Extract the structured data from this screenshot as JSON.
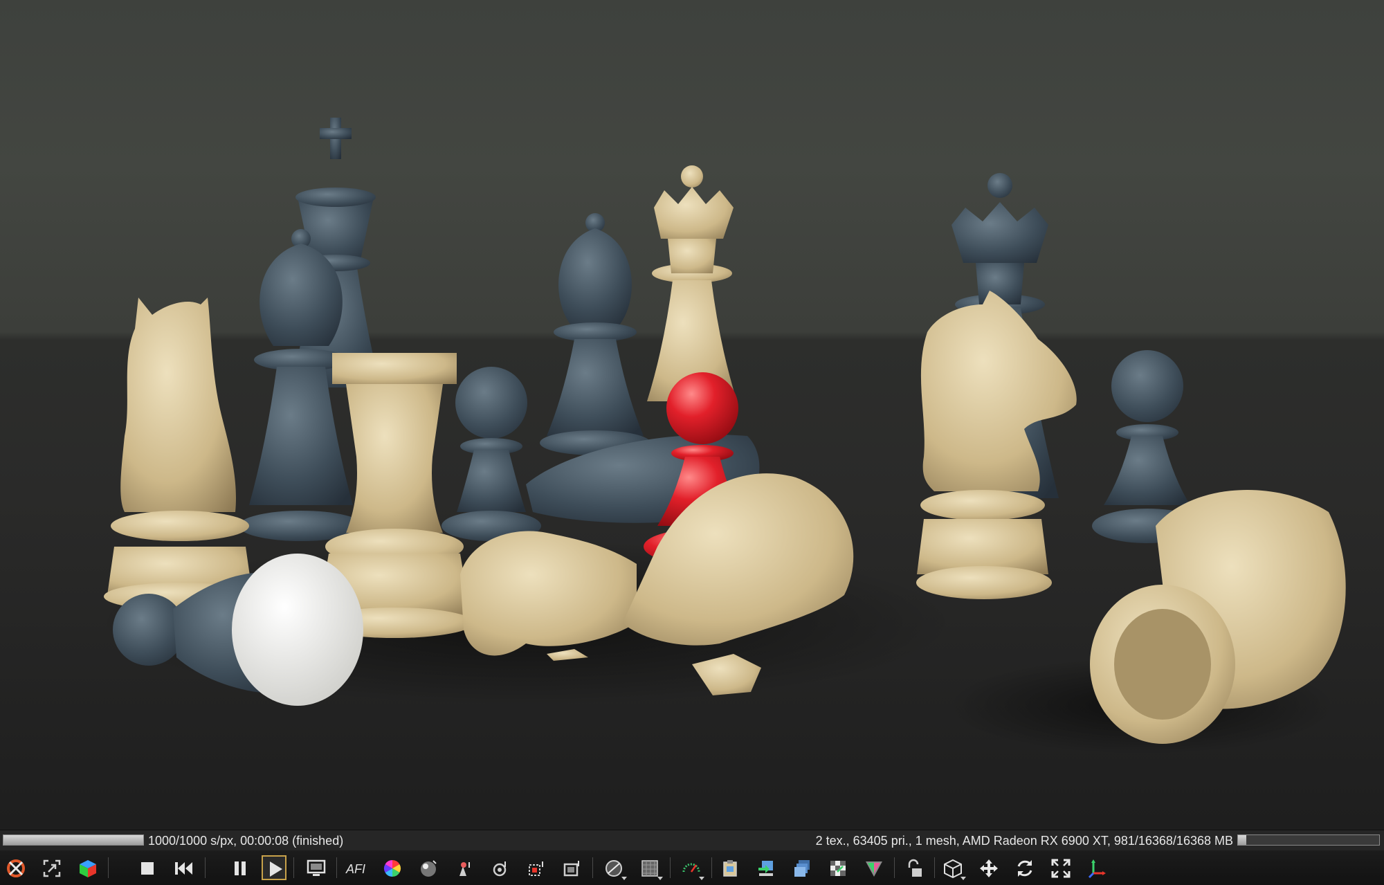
{
  "status": {
    "render_progress": 1.0,
    "gpu_progress": 0.06,
    "left_text": "1000/1000 s/px, 00:00:08 (finished)",
    "right_text": "2 tex., 63405 pri., 1 mesh, AMD Radeon RX 6900 XT, 981/16368/16368 MB"
  },
  "toolbar": {
    "afi_label": "AFI",
    "buttons": [
      {
        "name": "render-reset-icon"
      },
      {
        "name": "region-select-icon"
      },
      {
        "name": "color-cube-icon"
      },
      {
        "name": "stop-icon"
      },
      {
        "name": "restart-icon"
      },
      {
        "name": "pause-icon"
      },
      {
        "name": "play-icon",
        "active": true
      },
      {
        "name": "display-settings-icon"
      },
      {
        "name": "afi-icon"
      },
      {
        "name": "color-wheel-icon"
      },
      {
        "name": "material-sphere-icon"
      },
      {
        "name": "light-pick-icon"
      },
      {
        "name": "camera-pick-icon"
      },
      {
        "name": "region-render-icon"
      },
      {
        "name": "film-region-icon"
      },
      {
        "name": "lens-icon"
      },
      {
        "name": "alpha-grid-icon"
      },
      {
        "name": "performance-gauge-icon"
      },
      {
        "name": "copy-clipboard-icon"
      },
      {
        "name": "save-image-icon"
      },
      {
        "name": "layers-icon"
      },
      {
        "name": "checker-icon"
      },
      {
        "name": "prism-icon"
      },
      {
        "name": "lock-icon"
      },
      {
        "name": "cube-view-icon"
      },
      {
        "name": "move-icon"
      },
      {
        "name": "rotate-icon"
      },
      {
        "name": "fullscreen-icon"
      },
      {
        "name": "axis-gizmo-icon"
      }
    ]
  },
  "colors": {
    "accent": "#c8a24a",
    "status_bg": "#262626",
    "toolbar_bg": "#161616"
  }
}
